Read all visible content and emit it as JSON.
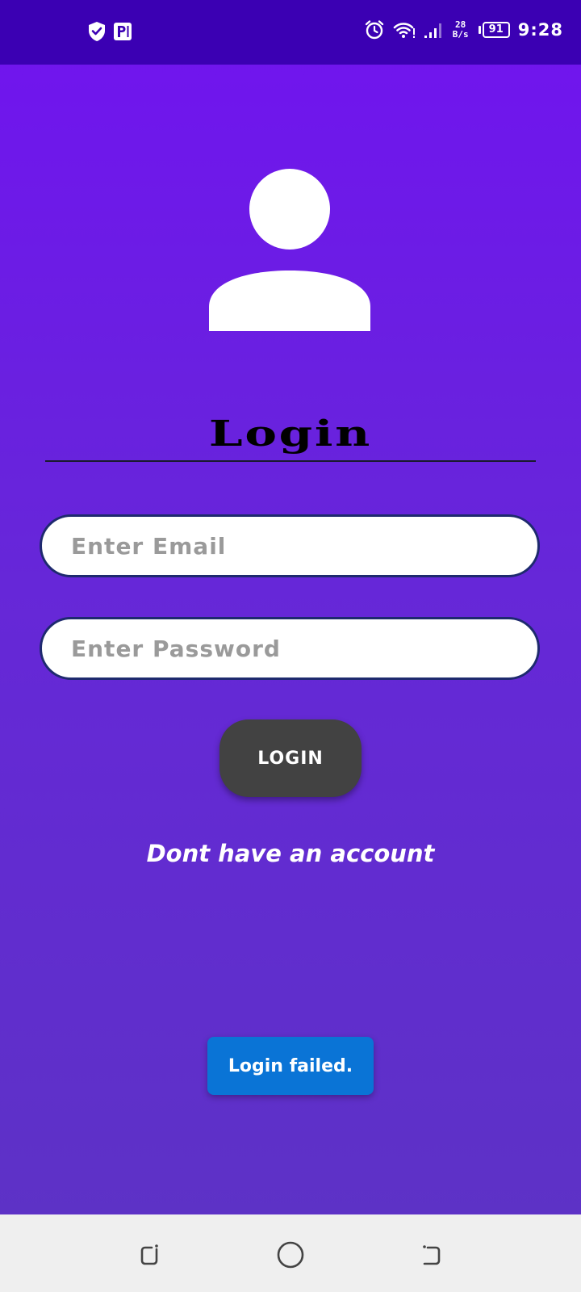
{
  "status_bar": {
    "net_speed_value": "28",
    "net_speed_unit": "B/s",
    "battery": "91",
    "time": "9:28"
  },
  "main": {
    "title": "Login",
    "email_placeholder": "Enter Email",
    "password_placeholder": "Enter Password",
    "login_button": "LOGIN",
    "signup_link": "Dont have an account"
  },
  "toast": {
    "message": "Login failed."
  },
  "icons": {
    "status_left": [
      "shield-check-icon",
      "parking-app-icon"
    ],
    "status_right": [
      "alarm-icon",
      "wifi-icon",
      "signal-icon"
    ],
    "avatar": "person-icon",
    "nav": [
      "recents-icon",
      "home-icon",
      "back-icon"
    ]
  },
  "colors": {
    "background_top": "#7113f0",
    "background_bottom": "#5c33c4",
    "status_bar": "#3b00b3",
    "login_button": "#424242",
    "toast": "#0a74d6",
    "field_border": "#1e2a6e",
    "nav_bar": "#efefef"
  }
}
